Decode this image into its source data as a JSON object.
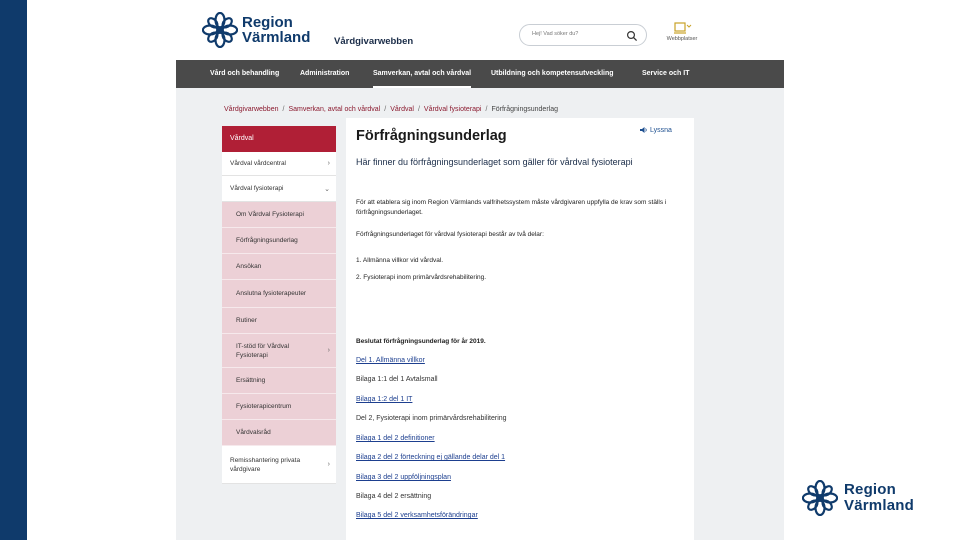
{
  "brand": {
    "line1": "Region",
    "line2": "Värmland",
    "color": "#0f3a6b"
  },
  "header": {
    "site_name": "Vårdgivarwebben",
    "search_placeholder": "Hej! Vad söker du?",
    "tools_label": "Webbplatser"
  },
  "nav": {
    "items": [
      "Vård och behandling",
      "Administration",
      "Samverkan, avtal och vårdval",
      "Utbildning och kompetensutveckling",
      "Service och IT"
    ],
    "active_index": 2
  },
  "breadcrumb": [
    "Vårdgivarwebben",
    "Samverkan, avtal och vårdval",
    "Vårdval",
    "Vårdval fysioterapi",
    "Förfrågningsunderlag"
  ],
  "sidebar": {
    "heading": "Vårdval",
    "items": [
      {
        "label": "Vårdval vårdcentral",
        "chevron": "›"
      },
      {
        "label": "Vårdval fysioterapi",
        "chevron": "⌄"
      }
    ],
    "subitems": [
      {
        "label": "Om Vårdval Fysioterapi"
      },
      {
        "label": "Förfrågningsunderlag"
      },
      {
        "label": "Ansökan"
      },
      {
        "label": "Anslutna fysioterapeuter"
      },
      {
        "label": "Rutiner"
      },
      {
        "label": "IT-stöd för Vårdval Fysioterapi",
        "chevron": "›"
      },
      {
        "label": "Ersättning"
      },
      {
        "label": "Fysioterapicentrum"
      },
      {
        "label": "Vårdvalsråd"
      }
    ],
    "last": {
      "label": "Remisshantering privata vårdgivare",
      "chevron": "›"
    }
  },
  "main": {
    "listen": "Lyssna",
    "title": "Förfrågningsunderlag",
    "lead": "Här finner du förfrågningsunderlaget som gäller för vårdval fysioterapi",
    "p1": "För att etablera sig inom Region Värmlands valfrihetssystem måste vårdgivaren uppfylla de krav som ställs i förfrågningsunderlaget.",
    "p2": "Förfrågningsunderlaget för vårdval fysioterapi består av två delar:",
    "p3": "1. Allmänna villkor vid vårdval.",
    "p4": "2. Fysioterapi inom primärvårdsrehabilitering.",
    "subheading": "Beslutat förfrågningsunderlag för år 2019.",
    "docs": [
      {
        "text": "Del 1. Allmänna villkor",
        "link": true
      },
      {
        "text": "Bilaga 1:1 del 1 Avtalsmall",
        "link": false
      },
      {
        "text": "Bilaga 1:2 del 1 IT",
        "link": true
      },
      {
        "text": "Del 2, Fysioterapi inom primärvårdsrehabilitering",
        "link": false
      },
      {
        "text": "Bilaga 1 del 2 definitioner",
        "link": true
      },
      {
        "text": "Bilaga 2 del 2 förteckning ej gällande delar del 1",
        "link": true
      },
      {
        "text": "Bilaga 3 del 2 uppföljningsplan",
        "link": true
      },
      {
        "text": "Bilaga 4 del 2 ersättning",
        "link": false
      },
      {
        "text": "Bilaga 5 del 2 verksamhetsförändringar",
        "link": true
      }
    ]
  }
}
